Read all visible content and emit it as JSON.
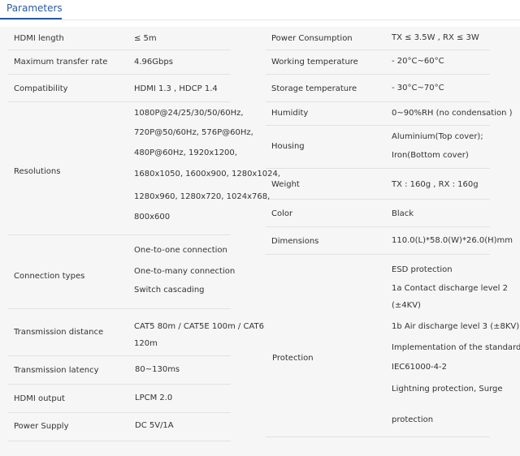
{
  "page": {
    "title": "Parameters"
  },
  "left": [
    {
      "label": "HDMI length",
      "value": [
        "≤ 5m"
      ]
    },
    {
      "label": "Maximum transfer rate",
      "value": [
        "4.96Gbps"
      ]
    },
    {
      "label": "Compatibility",
      "value": [
        "HDMI 1.3 , HDCP 1.4"
      ]
    },
    {
      "label": "Resolutions",
      "value": [
        "1080P@24/25/30/50/60Hz,",
        "720P@50/60Hz, 576P@60Hz,",
        "480P@60Hz, 1920x1200,",
        "1680x1050, 1600x900, 1280x1024,",
        "1280x960, 1280x720, 1024x768,",
        "800x600"
      ]
    },
    {
      "label": "Connection types",
      "value": [
        "One-to-one connection",
        "One-to-many connection",
        "Switch cascading"
      ]
    },
    {
      "label": "Transmission distance",
      "value": [
        "CAT5 80m / CAT5E 100m / CAT6",
        "120m"
      ]
    },
    {
      "label": "Transmission latency",
      "value": [
        "80~130ms"
      ]
    },
    {
      "label": "HDMI output",
      "value": [
        "LPCM 2.0"
      ]
    },
    {
      "label": "Power Supply",
      "value": [
        "DC 5V/1A"
      ]
    }
  ],
  "right": [
    {
      "label": "Power Consumption",
      "value": [
        "TX ≤ 3.5W , RX ≤ 3W"
      ]
    },
    {
      "label": "Working temperature",
      "value": [
        "- 20°C~60°C"
      ]
    },
    {
      "label": "Storage temperature",
      "value": [
        "- 30°C~70°C"
      ]
    },
    {
      "label": "Humidity",
      "value": [
        "0~90%RH (no condensation )"
      ]
    },
    {
      "label": "Housing",
      "value": [
        "Aluminium(Top cover);",
        "Iron(Bottom cover)"
      ]
    },
    {
      "label": "Weight",
      "value": [
        "TX : 160g , RX : 160g"
      ]
    },
    {
      "label": "Color",
      "value": [
        "Black"
      ]
    },
    {
      "label": "Dimensions",
      "value": [
        "110.0(L)*58.0(W)*26.0(H)mm"
      ]
    },
    {
      "label": "Protection",
      "value": [
        "ESD protection",
        "1a Contact discharge level 2",
        "(±4KV)",
        "1b Air discharge level 3 (±8KV)",
        "Implementation of the standard:",
        "IEC61000-4-2",
        "Lightning protection, Surge",
        "protection"
      ]
    }
  ]
}
